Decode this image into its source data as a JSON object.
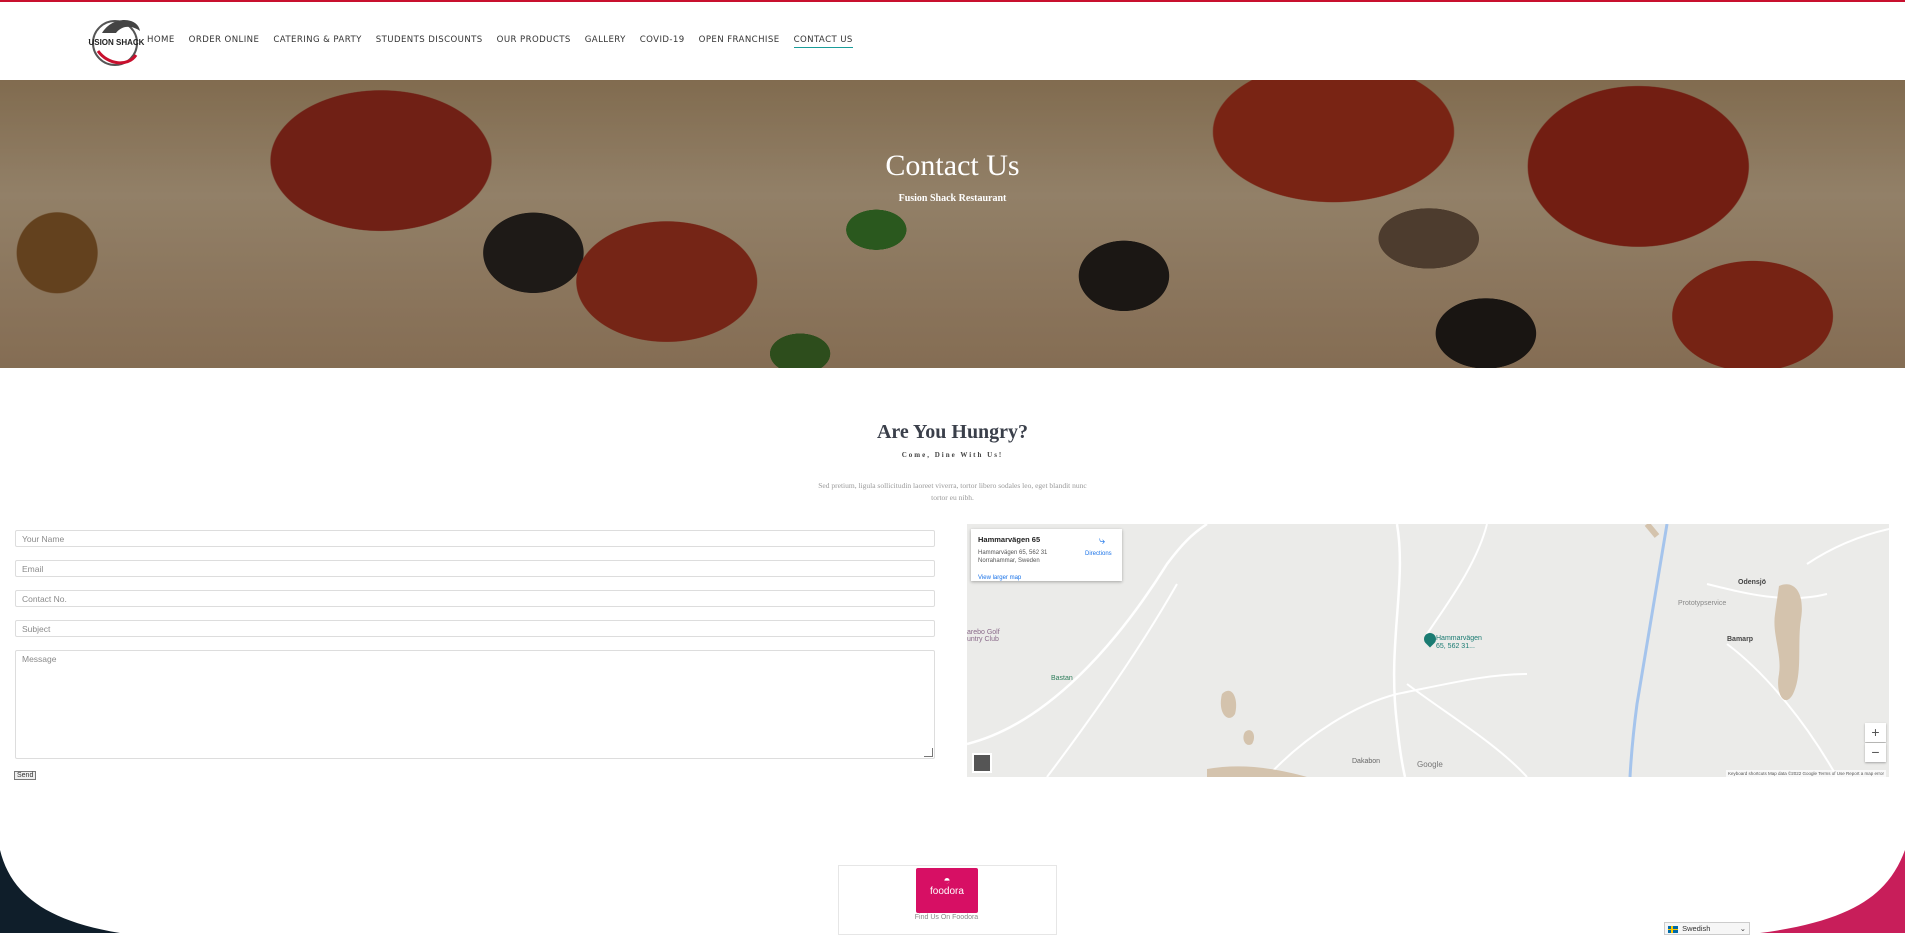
{
  "nav": {
    "items": [
      {
        "label": "HOME"
      },
      {
        "label": "ORDER ONLINE"
      },
      {
        "label": "CATERING & PARTY"
      },
      {
        "label": "STUDENTS DISCOUNTS"
      },
      {
        "label": "OUR PRODUCTS"
      },
      {
        "label": "GALLERY"
      },
      {
        "label": "COVID-19"
      },
      {
        "label": "OPEN FRANCHISE"
      },
      {
        "label": "CONTACT US",
        "active": true
      }
    ]
  },
  "logo": {
    "text": "FUSION SHACK"
  },
  "hero": {
    "title": "Contact Us",
    "subtitle": "Fusion Shack Restaurant"
  },
  "section": {
    "title": "Are You Hungry?",
    "subtitle": "Come, Dine With Us!",
    "paragraph": "Sed pretium, ligula sollicitudin laoreet viverra, tortor libero sodales leo, eget blandit nunc tortor eu nibh."
  },
  "form": {
    "name_placeholder": "Your Name",
    "email_placeholder": "Email",
    "contact_placeholder": "Contact No.",
    "subject_placeholder": "Subject",
    "message_placeholder": "Message",
    "send_label": "Send"
  },
  "map": {
    "card_title": "Hammarvägen 65",
    "card_address_1": "Hammarvägen 65, 562 31",
    "card_address_2": "Norrahammar, Sweden",
    "larger_map": "View larger map",
    "directions": "Directions",
    "pin_label_1": "Hammarvägen",
    "pin_label_2": "65, 562 31...",
    "places": {
      "odensjo": "Odensjö",
      "bamarp": "Bamarp",
      "prototypservice": "Prototypservice",
      "golf_1": "arebo Golf",
      "golf_2": "untry Club",
      "bastan": "Bastan",
      "dakabon": "Dakabon"
    },
    "google": "Google",
    "zoom_in": "+",
    "zoom_out": "−",
    "attribution": "Keyboard shortcuts   Map data ©2022 Google   Terms of Use   Report a map error"
  },
  "footer": {
    "foodora_label": "foodora",
    "find_us": "Find Us On Foodora",
    "language": "Swedish"
  },
  "colors": {
    "accent": "#c8102e",
    "nav_active_underline": "#1a9d9a",
    "foodora": "#d70f64",
    "footer_dark": "#0f1e2a"
  }
}
